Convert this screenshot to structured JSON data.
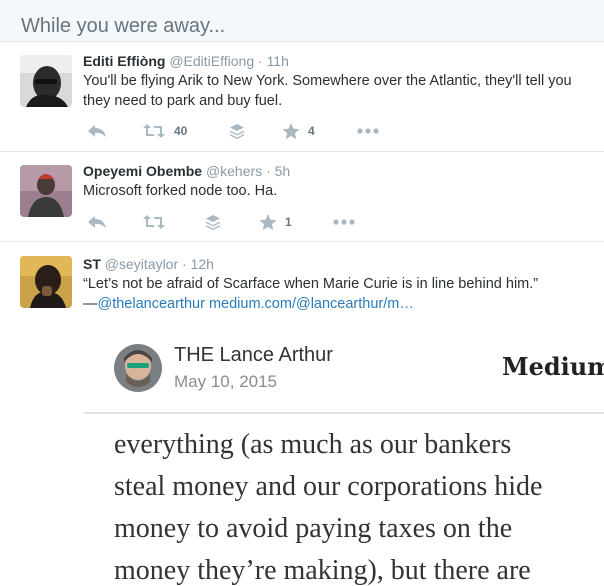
{
  "header": {
    "title": "While you were away..."
  },
  "tweets": [
    {
      "fullname": "Editi Effiòng",
      "username": "@EditiEffiong",
      "separator": "·",
      "time": "11h",
      "text_lines": [
        "You'll be flying Arik to New York. Somewhere over the Atlantic, they'll tell you",
        "they need to park and buy fuel."
      ],
      "retweet_count": "40",
      "favorite_count": "4"
    },
    {
      "fullname": "Opeyemi Obembe",
      "username": "@kehers",
      "separator": "·",
      "time": "5h",
      "text_lines": [
        "Microsoft forked node too. Ha."
      ],
      "retweet_count": "",
      "favorite_count": "1"
    },
    {
      "fullname": "ST",
      "username": "@seyitaylor",
      "separator": "·",
      "time": "12h",
      "text_lines": [
        "“Let’s not be afraid of Scarface when Marie Curie is in line behind him.”"
      ],
      "quote_prefix": "—",
      "mention": "@thelancearthur",
      "link": "medium.com/@lancearthur/m…"
    }
  ],
  "card": {
    "author": "THE Lance Arthur",
    "date": "May 10, 2015",
    "brand": "Medium",
    "body_lines": [
      "everything (as much as our bankers",
      "steal money and our corporations hide",
      "money to avoid paying taxes on the",
      "money they’re making), but there are"
    ]
  },
  "icons": {
    "reply": "reply-icon",
    "retweet": "retweet-icon",
    "stack": "pocket-icon",
    "favorite": "star-icon",
    "more": "more-icon"
  },
  "colors": {
    "action_icon": "#aab8c2",
    "link": "#2b7bb9",
    "header_bg": "#f5f8fa"
  }
}
